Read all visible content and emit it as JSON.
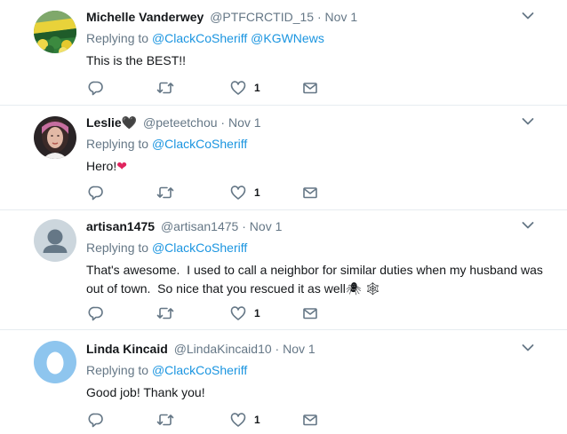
{
  "tweets": [
    {
      "name": "Michelle Vanderwey",
      "name_suffix": "",
      "handle": "@PTFCRCTID_15",
      "dot": "·",
      "time": "Nov 1",
      "replying_label": "Replying to",
      "mentions": [
        "@ClackCoSheriff",
        "@KGWNews"
      ],
      "text": "This is the BEST!!",
      "like_count": "1",
      "avatar": "green-yellow-crowd-avatar"
    },
    {
      "name": "Leslie",
      "name_suffix": "🖤",
      "handle": "@peteetchou",
      "dot": "·",
      "time": "Nov 1",
      "replying_label": "Replying to",
      "mentions": [
        "@ClackCoSheriff"
      ],
      "text": "Hero!",
      "text_suffix": "❤",
      "like_count": "1",
      "avatar": "woman-photo-avatar"
    },
    {
      "name": "artisan1475",
      "name_suffix": "",
      "handle": "@artisan1475",
      "dot": "·",
      "time": "Nov 1",
      "replying_label": "Replying to",
      "mentions": [
        "@ClackCoSheriff"
      ],
      "text": "That's awesome.  I used to call a neighbor for similar duties when my husband was out of town.  So nice that you rescued it as well",
      "text_suffix": "🕷 🕸",
      "like_count": "1",
      "avatar": "default-person-avatar"
    },
    {
      "name": "Linda Kincaid",
      "name_suffix": "",
      "handle": "@LindaKincaid10",
      "dot": "·",
      "time": "Nov 1",
      "replying_label": "Replying to",
      "mentions": [
        "@ClackCoSheriff"
      ],
      "text": "Good job! Thank you!",
      "like_count": "1",
      "avatar": "egg-avatar"
    }
  ],
  "colors": {
    "link": "#1b95e0",
    "secondary_text": "#657786",
    "primary_text": "#14171a",
    "divider": "#e6ecf0",
    "heart": "#e0245e"
  },
  "icons": {
    "reply": "reply-icon",
    "retweet": "retweet-icon",
    "like": "heart-icon",
    "message": "envelope-icon",
    "menu": "chevron-down-icon"
  }
}
